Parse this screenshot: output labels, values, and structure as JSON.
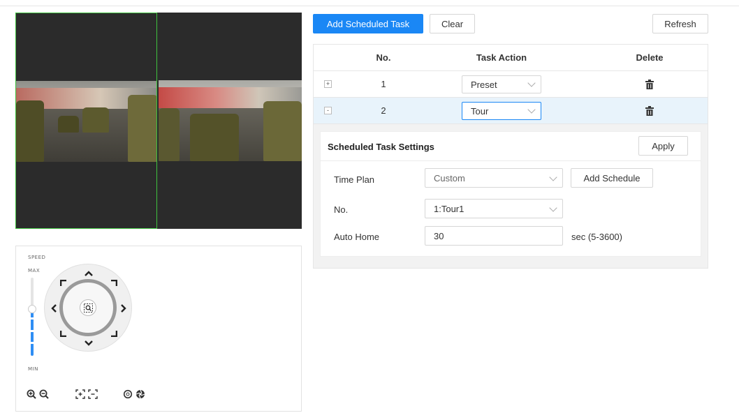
{
  "toolbar": {
    "add_label": "Add Scheduled Task",
    "clear_label": "Clear",
    "refresh_label": "Refresh"
  },
  "table": {
    "headers": {
      "no": "No.",
      "action": "Task Action",
      "delete": "Delete"
    },
    "rows": [
      {
        "expand": "+",
        "no": "1",
        "action": "Preset",
        "selected": false
      },
      {
        "expand": "-",
        "no": "2",
        "action": "Tour",
        "selected": true
      }
    ]
  },
  "settings": {
    "title": "Scheduled Task Settings",
    "apply_label": "Apply",
    "time_plan_label": "Time Plan",
    "time_plan_value": "Custom",
    "add_schedule_label": "Add Schedule",
    "no_label": "No.",
    "no_value": "1:Tour1",
    "auto_home_label": "Auto Home",
    "auto_home_value": "30",
    "auto_home_unit": "sec (5-3600)"
  },
  "ptz": {
    "speed_label": "SPEED",
    "max_label": "MAX",
    "min_label": "MIN",
    "speed_level": 0.6,
    "icons": [
      "zoom-in-icon",
      "zoom-out-icon",
      "focus-near-icon",
      "focus-far-icon",
      "iris-open-icon",
      "iris-close-icon"
    ]
  },
  "colors": {
    "primary": "#1a87f5",
    "selected_row": "#e8f3fb",
    "active_pane": "#3ec13e",
    "speed_bar": "#2f8ef4"
  }
}
